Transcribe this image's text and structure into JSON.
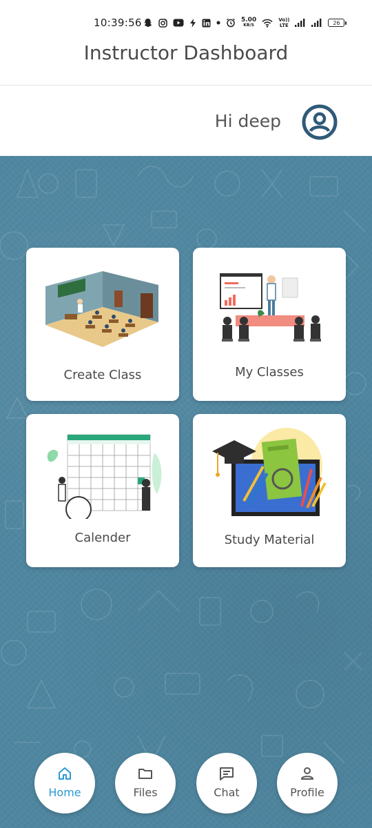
{
  "status_bar": {
    "time": "10:39:56",
    "net_speed_value": "5.00",
    "net_speed_unit": "KB/S",
    "volte_label": "Vo))",
    "lte_label": "LTE",
    "battery_level": "26",
    "icons": [
      "snapchat-icon",
      "instagram-icon",
      "youtube-icon",
      "flash-icon",
      "linkedin-icon",
      "dot-icon",
      "alarm-icon",
      "wifi-icon",
      "signal-icon",
      "signal-icon",
      "battery-icon"
    ]
  },
  "header": {
    "title": "Instructor Dashboard"
  },
  "greeting": {
    "text": "Hi deep",
    "avatar_icon": "user-circle-icon",
    "avatar_color": "#2f5a78"
  },
  "background": {
    "color": "#4f86a0"
  },
  "cards": [
    {
      "label": "Create Class",
      "icon": "classroom-illustration"
    },
    {
      "label": "My Classes",
      "icon": "presentation-illustration"
    },
    {
      "label": "Calender",
      "icon": "calendar-illustration"
    },
    {
      "label": "Study Material",
      "icon": "study-material-illustration"
    }
  ],
  "bottom_nav": {
    "active_color": "#2b9ad6",
    "items": [
      {
        "label": "Home",
        "icon": "home-icon",
        "active": true
      },
      {
        "label": "Files",
        "icon": "folder-icon",
        "active": false
      },
      {
        "label": "Chat",
        "icon": "chat-icon",
        "active": false
      },
      {
        "label": "Profile",
        "icon": "profile-icon",
        "active": false
      }
    ]
  }
}
